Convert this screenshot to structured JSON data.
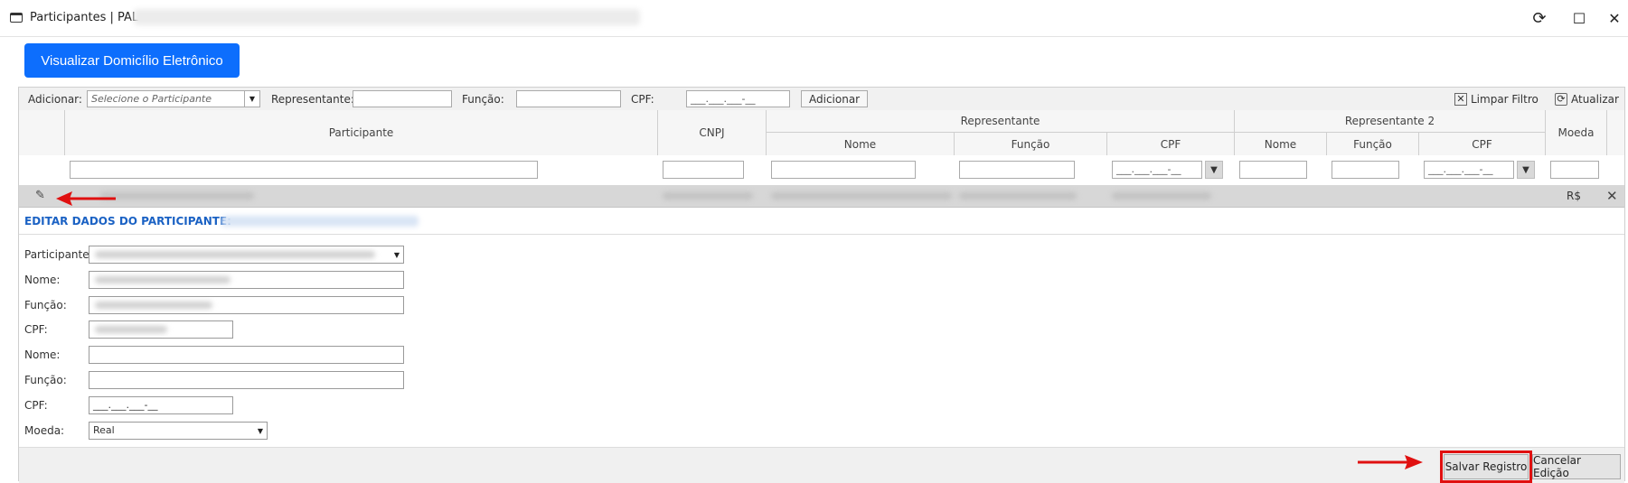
{
  "window": {
    "title": "Participantes | PAL",
    "buttons": {
      "refresh": "⟳",
      "maximize": "☐",
      "close": "✕"
    }
  },
  "main_button": "Visualizar Domicílio Eletrônico",
  "toolbar": {
    "add_label": "Adicionar:",
    "participant_placeholder": "Selecione o Participante",
    "representative_label": "Representante:",
    "function_label": "Função:",
    "cpf_label": "CPF:",
    "cpf_mask": "___.___.___-__",
    "add_button": "Adicionar",
    "clear_filter": "Limpar Filtro",
    "refresh": "Atualizar"
  },
  "grid": {
    "headers": {
      "participant": "Participante",
      "cnpj": "CNPJ",
      "representative": "Representante",
      "representative2": "Representante 2",
      "currency": "Moeda",
      "name": "Nome",
      "function": "Função",
      "cpf": "CPF"
    },
    "filter_cpf_mask": "___.___.___-__",
    "row": {
      "currency": "R$"
    }
  },
  "edit_form": {
    "title": "EDITAR DADOS DO PARTICIPANTE:",
    "labels": {
      "participant": "Participante:",
      "name1": "Nome:",
      "function1": "Função:",
      "cpf1": "CPF:",
      "name2": "Nome:",
      "function2": "Função:",
      "cpf2": "CPF:",
      "currency": "Moeda:"
    },
    "cpf2_value": "___.___.___-__",
    "currency_value": "Real"
  },
  "footer": {
    "save": "Salvar Registro",
    "cancel": "Cancelar Edição"
  },
  "colors": {
    "primary": "#0d6efd",
    "highlight": "#e01010",
    "title_blue": "#1b62c4"
  }
}
